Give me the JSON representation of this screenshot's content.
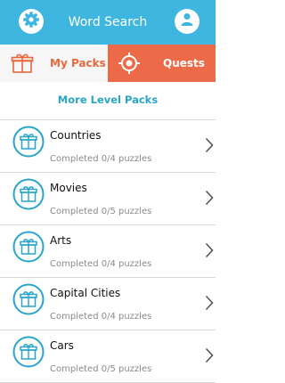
{
  "header": {
    "title": "Word Search",
    "settings_icon": "gear-icon",
    "profile_icon": "user-icon"
  },
  "tabs": [
    {
      "label": "My Packs",
      "icon": "gift-icon",
      "active": true
    },
    {
      "label": "Quests",
      "icon": "target-icon",
      "active": false
    }
  ],
  "more_level_packs": "More Level Packs",
  "packs": [
    {
      "name": "Countries",
      "progress": "Completed 0/4 puzzles"
    },
    {
      "name": "Movies",
      "progress": "Completed 0/5 puzzles"
    },
    {
      "name": "Arts",
      "progress": "Completed 0/4 puzzles"
    },
    {
      "name": "Capital Cities",
      "progress": "Completed 0/4 puzzles"
    },
    {
      "name": "Cars",
      "progress": "Completed 0/5 puzzles"
    }
  ],
  "colors": {
    "header": "#3fb6df",
    "accent_orange": "#ec6a47",
    "teal": "#2aa5c9"
  }
}
